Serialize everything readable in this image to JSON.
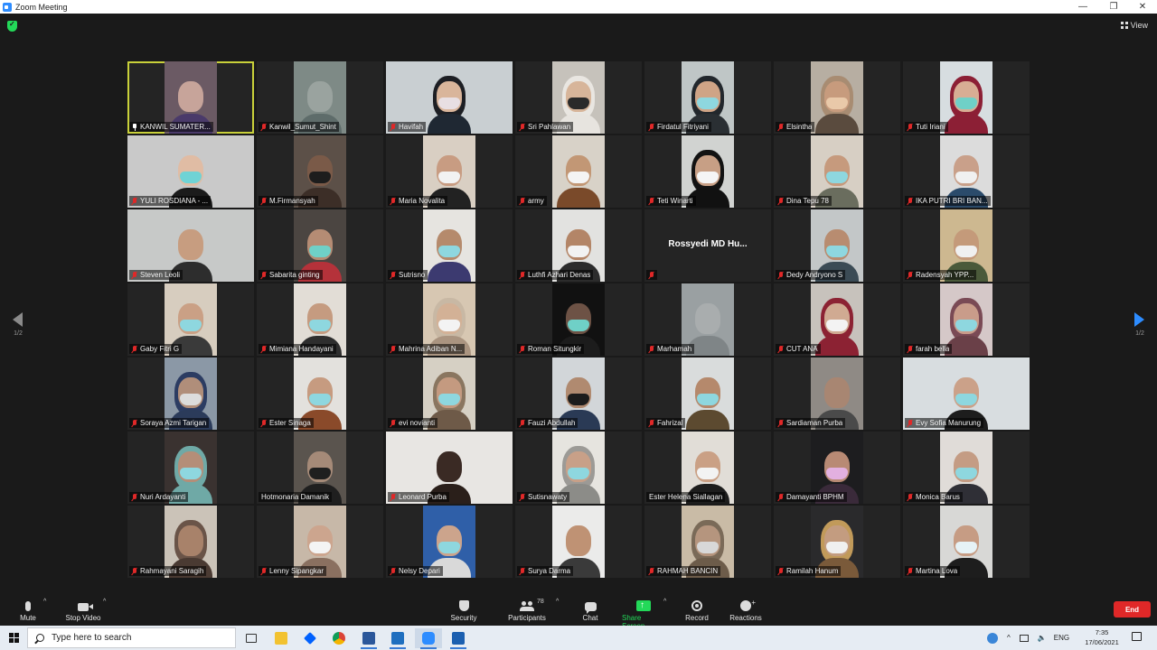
{
  "window": {
    "title": "Zoom Meeting"
  },
  "top": {
    "view_label": "View"
  },
  "pager": {
    "left_page": "1/2",
    "right_page": "1/2"
  },
  "participants": [
    {
      "name": "KANWIL SUMATER...",
      "mic": "pin",
      "active": true,
      "bg": "#6b5a64",
      "skin": "#c7a49a",
      "shirt": "#4a3a6a",
      "mask": false,
      "scene": "room"
    },
    {
      "name": "Kanwil_Sumut_Shint",
      "mic": "muted",
      "bg": "#7e8a86",
      "skin": "#9aa39f",
      "shirt": "#5e6c6a",
      "mask": false,
      "scene": "office"
    },
    {
      "name": "Havifah",
      "mic": "muted",
      "bg": "#c9cfd2",
      "skin": "#d9b59b",
      "shirt": "#1f2833",
      "mask": "#e8dfe3",
      "hijab": "#1d1f24",
      "wide": true
    },
    {
      "name": "Sri Pahlawan",
      "mic": "muted",
      "bg": "#c6c2bb",
      "skin": "#d7b59a",
      "shirt": "#e7e4df",
      "mask": "#2a2a2a",
      "hijab": "#e9e6e1"
    },
    {
      "name": "Firdatul Fitriyani",
      "mic": "muted",
      "bg": "#bfc6c6",
      "skin": "#cfa486",
      "shirt": "#2a2f33",
      "mask": "#8ed7df",
      "hijab": "#22272c"
    },
    {
      "name": "Elsintha",
      "mic": "muted",
      "bg": "#b7aea2",
      "skin": "#c79b7d",
      "shirt": "#5a4b3e",
      "mask": "#e9c9a9",
      "hijab": "#a88c72"
    },
    {
      "name": "Tuti Iriani",
      "mic": "muted",
      "bg": "#d7dde0",
      "skin": "#d8ad94",
      "shirt": "#8c1f35",
      "mask": "#6fd0c7",
      "hijab": "#8c1f35"
    },
    {
      "name": "YULI ROSDIANA - ...",
      "mic": "muted",
      "bg": "#c9c9c9",
      "skin": "#e0bca4",
      "shirt": "#1b1b1b",
      "mask": "#6fd3d5",
      "wide": true
    },
    {
      "name": "M.Firmansyah",
      "mic": "muted",
      "bg": "#5c5048",
      "skin": "#7a5a48",
      "shirt": "#3c2e27",
      "mask": "#1d1d1d"
    },
    {
      "name": "Maria Novalita",
      "mic": "muted",
      "bg": "#d9cfc3",
      "skin": "#c89c82",
      "shirt": "#222222",
      "mask": "#f2f2f2"
    },
    {
      "name": "army",
      "mic": "muted",
      "bg": "#d8d2c8",
      "skin": "#c29775",
      "shirt": "#7a4a2a",
      "mask": "#f4f4f4"
    },
    {
      "name": "Teti Winarti",
      "mic": "muted",
      "bg": "#d1d3d1",
      "skin": "#c79f85",
      "shirt": "#111111",
      "mask": "#f5f5f5",
      "hijab": "#121212"
    },
    {
      "name": "Dina Tepu 78",
      "mic": "muted",
      "bg": "#d7cfc4",
      "skin": "#c69a7d",
      "shirt": "#6a6d5e",
      "mask": "#8ed7df"
    },
    {
      "name": "IKA PUTRI BRI BAN...",
      "mic": "muted",
      "bg": "#dcdcdc",
      "skin": "#c9a08a",
      "shirt": "#2b4b6b",
      "mask": "#f0f0f0"
    },
    {
      "name": "Steven Leoli",
      "mic": "muted",
      "bg": "#c7c9c8",
      "skin": "#c79d80",
      "shirt": "#2d2d2d",
      "mask": false,
      "wide": true
    },
    {
      "name": "Sabarita ginting",
      "mic": "muted",
      "bg": "#4b4541",
      "skin": "#b58c74",
      "shirt": "#b5323a",
      "mask": "#6fd0c7"
    },
    {
      "name": "Sutrisno",
      "mic": "muted",
      "bg": "#e6e4e0",
      "skin": "#b58a6c",
      "shirt": "#3c3a70",
      "mask": "#8ed7df"
    },
    {
      "name": "Luthfi Azhari Denas",
      "mic": "muted",
      "bg": "#e2e2e0",
      "skin": "#b38567",
      "shirt": "#2c2c2c",
      "mask": "#f2f2f2"
    },
    {
      "name": "",
      "mic": "muted",
      "nocam": "Rossyedi MD Hu..."
    },
    {
      "name": "Dedy Andryono S",
      "mic": "muted",
      "bg": "#c3c7c8",
      "skin": "#b88c70",
      "shirt": "#3b4b55",
      "mask": "#8ed7df"
    },
    {
      "name": "Radensyah YPP...",
      "mic": "muted",
      "bg": "#cdb890",
      "skin": "#c49a7a",
      "shirt": "#4a5a3a",
      "mask": "#f0f0f0"
    },
    {
      "name": "Gaby Fitri G",
      "mic": "muted",
      "bg": "#d7cdbf",
      "skin": "#caa085",
      "shirt": "#3a3a3a",
      "mask": "#8ed7df"
    },
    {
      "name": "Mimiana Handayani",
      "mic": "muted",
      "bg": "#e2ddd6",
      "skin": "#c59b80",
      "shirt": "#2e2e2e",
      "mask": "#8ed7df"
    },
    {
      "name": "Mahrina Adiban N...",
      "mic": "muted",
      "bg": "#d7c7b2",
      "skin": "#d3b196",
      "shirt": "#aa9480",
      "mask": "#f3f3f3",
      "hijab": "#c8b8a4"
    },
    {
      "name": "Roman Situngkir",
      "mic": "muted",
      "bg": "#111111",
      "skin": "#6d5245",
      "shirt": "#1c1c1c",
      "mask": "#6fd0c7"
    },
    {
      "name": "Marhamah",
      "mic": "muted",
      "bg": "#9aa0a2",
      "skin": "#a9adae",
      "shirt": "#7f8587",
      "mask": false
    },
    {
      "name": "CUT ANA",
      "mic": "muted",
      "bg": "#c7c2bc",
      "skin": "#d0aa92",
      "shirt": "#8c2233",
      "mask": "#f3f3f3",
      "hijab": "#8c2233"
    },
    {
      "name": "farah bella",
      "mic": "muted",
      "bg": "#d5c8c8",
      "skin": "#c99c8a",
      "shirt": "#6a4048",
      "mask": "#8ed7df",
      "hijab": "#7a4a55"
    },
    {
      "name": "Soraya Azmi Tarigan",
      "mic": "muted",
      "bg": "#8b98a6",
      "skin": "#b08e7a",
      "shirt": "#2b3b5a",
      "mask": "#dcdcdc",
      "hijab": "#2c3c62"
    },
    {
      "name": "Ester Sinaga",
      "mic": "muted",
      "bg": "#e3e1dd",
      "skin": "#c69b80",
      "shirt": "#8a4a2a",
      "mask": "#8ed7df"
    },
    {
      "name": "evi novianti",
      "mic": "muted",
      "bg": "#d6d0c4",
      "skin": "#c49a80",
      "shirt": "#6e5a48",
      "mask": "#8ed7df",
      "hijab": "#8a7660"
    },
    {
      "name": "Fauzi Abdullah",
      "mic": "muted",
      "bg": "#d2d6d9",
      "skin": "#b08a70",
      "shirt": "#2a3a55",
      "mask": "#1c1c1c"
    },
    {
      "name": "Fahrizal",
      "mic": "muted",
      "bg": "#d9dcdc",
      "skin": "#b5896c",
      "shirt": "#5c4a30",
      "mask": "#8ed7df"
    },
    {
      "name": "Sardiaman Purba",
      "mic": "muted",
      "bg": "#8f8a85",
      "skin": "#a88672",
      "shirt": "#4a4a4a",
      "mask": false
    },
    {
      "name": "Evy Sofia Manurung",
      "mic": "muted",
      "bg": "#d8dde0",
      "skin": "#cba189",
      "shirt": "#1d1d1d",
      "mask": "#8ed7df",
      "wide": true
    },
    {
      "name": "Nuri Ardayanti",
      "mic": "muted",
      "bg": "#3a3230",
      "skin": "#b48e78",
      "shirt": "#6fa9a6",
      "mask": "#8ed7df",
      "hijab": "#6fa9a6"
    },
    {
      "name": "Hotmonaria Damanik",
      "mic": "none",
      "bg": "#5a544e",
      "skin": "#a58a78",
      "shirt": "#1f1f1f",
      "mask": "#1f1f1f"
    },
    {
      "name": "Leonard Purba",
      "mic": "muted",
      "bg": "#e8e6e3",
      "skin": "#3a2a24",
      "shirt": "#2a1f1a",
      "mask": false,
      "wide": true
    },
    {
      "name": "Sutisnawaty",
      "mic": "muted",
      "bg": "#e6e4df",
      "skin": "#c8a088",
      "shirt": "#8c8c88",
      "mask": "#8ed7df",
      "hijab": "#9c9a96"
    },
    {
      "name": "Ester Helena Siallagan",
      "mic": "none",
      "bg": "#e1ddd7",
      "skin": "#caa085",
      "shirt": "#1d1d1d",
      "mask": "#f3f3f3"
    },
    {
      "name": "Damayanti BPHM",
      "mic": "muted",
      "bg": "#1d1d1f",
      "skin": "#b88a74",
      "shirt": "#3a2a3a",
      "mask": "#e2b0e0"
    },
    {
      "name": "Monica Barus",
      "mic": "muted",
      "bg": "#e0dcd8",
      "skin": "#c49c84",
      "shirt": "#2f2f36",
      "mask": "#8ed7df"
    },
    {
      "name": "Rahmayani Saragih",
      "mic": "muted",
      "bg": "#cbc3b8",
      "skin": "#a8826a",
      "shirt": "#4a3a32",
      "mask": false,
      "hijab": "#6a5448"
    },
    {
      "name": "Lenny Sipangkar",
      "mic": "muted",
      "bg": "#c7b8a8",
      "skin": "#cca58e",
      "shirt": "#8a7060",
      "mask": "#f4f4f4"
    },
    {
      "name": "Nelsy Depari",
      "mic": "muted",
      "bg": "#2f5fa8",
      "skin": "#cca48c",
      "shirt": "#d9d9d9",
      "mask": "#8ed7df"
    },
    {
      "name": "Surya Darma",
      "mic": "muted",
      "bg": "#ebebea",
      "skin": "#bf9274",
      "shirt": "#3a3a3a",
      "mask": false
    },
    {
      "name": "RAHMAH BANCIN",
      "mic": "muted",
      "bg": "#c9bba6",
      "skin": "#b5957e",
      "shirt": "#6d5c4a",
      "mask": "#d8d8d8",
      "hijab": "#7a6a58"
    },
    {
      "name": "Ramilah Hanum",
      "mic": "muted",
      "bg": "#2a2a2c",
      "skin": "#c39c80",
      "shirt": "#7a5a3a",
      "mask": "#f0f0f0",
      "hijab": "#c19a5a"
    },
    {
      "name": "Martina Lova",
      "mic": "muted",
      "bg": "#d8d8d6",
      "skin": "#c69c84",
      "shirt": "#1d1d1d",
      "mask": "#e6f2f6"
    }
  ],
  "toolbar": {
    "mute_label": "Mute",
    "stop_video_label": "Stop Video",
    "security_label": "Security",
    "participants_label": "Participants",
    "participants_count": "78",
    "chat_label": "Chat",
    "share_label": "Share Screen",
    "record_label": "Record",
    "reactions_label": "Reactions",
    "end_label": "End"
  },
  "taskbar": {
    "search_placeholder": "Type here to search",
    "lang": "ENG",
    "time": "7:35",
    "date": "17/06/2021"
  }
}
